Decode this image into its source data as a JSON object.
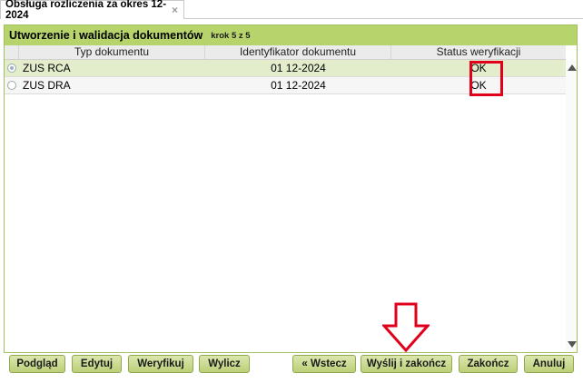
{
  "tab": {
    "title": "Obsługa rozliczenia za okres 12-2024",
    "close": "×"
  },
  "panel": {
    "title": "Utworzenie i walidacja dokumentów",
    "step": "krok 5 z 5"
  },
  "grid": {
    "columns": [
      "Typ dokumentu",
      "Identyfikator dokumentu",
      "Status weryfikacji"
    ],
    "rows": [
      {
        "type": "ZUS RCA",
        "id": "01 12-2024",
        "status": "OK",
        "selected": true
      },
      {
        "type": "ZUS DRA",
        "id": "01 12-2024",
        "status": "OK",
        "selected": false
      }
    ]
  },
  "buttons": {
    "preview": "Podgląd",
    "edit": "Edytuj",
    "verify": "Weryfikuj",
    "calculate": "Wylicz",
    "back": "« Wstecz",
    "send_finish": "Wyślij i zakończ",
    "finish": "Zakończ",
    "cancel": "Anuluj"
  },
  "colors": {
    "accent": "#b7d36b",
    "highlight": "#e0001b",
    "selected_row": "#e3edcc"
  }
}
